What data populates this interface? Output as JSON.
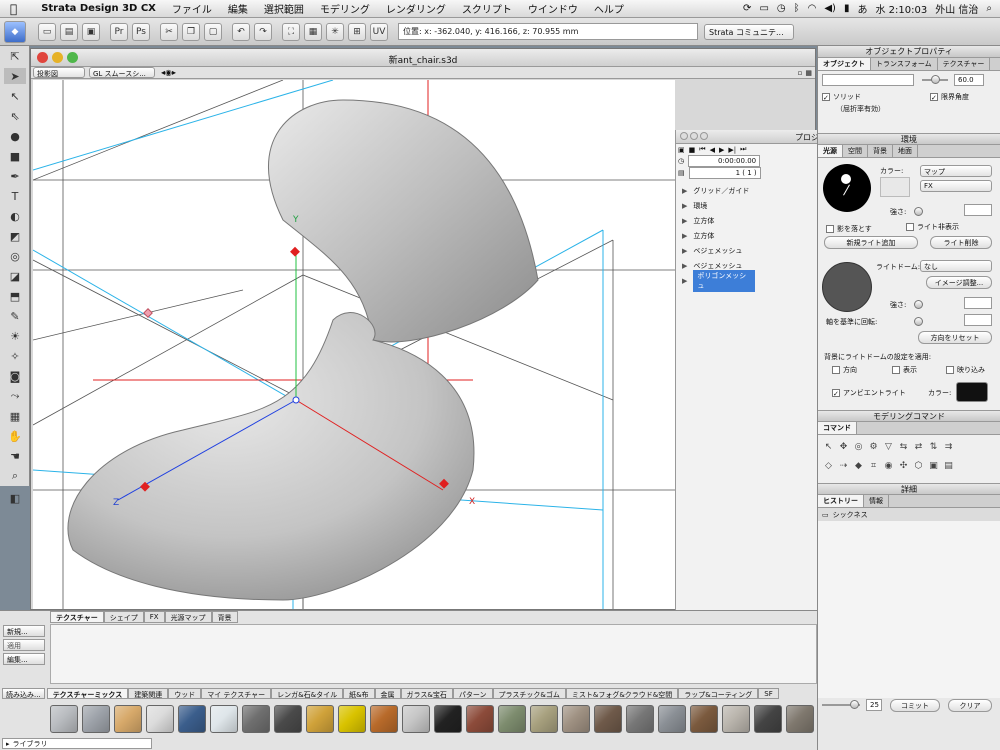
{
  "menubar": {
    "app": "Strata Design 3D CX",
    "items": [
      "ファイル",
      "編集",
      "選択範囲",
      "モデリング",
      "レンダリング",
      "スクリプト",
      "ウインドウ",
      "ヘルプ"
    ],
    "ime": "あ",
    "clock": "水 2:10:03",
    "user": "外山 信治"
  },
  "toolbar": {
    "coords": "位置: x: -362.040, y: 416.166, z: 70.955 mm",
    "community": "Strata コミュニテ..."
  },
  "viewport": {
    "title": "新ant_chair.s3d",
    "projection": "投影図",
    "renderer": "GL スムースシ...",
    "axis_labels": {
      "x": "X",
      "y": "Y",
      "z": "Z"
    }
  },
  "project": {
    "title": "プロジ",
    "time": "0:00:00.00",
    "frame": "1 ( 1 )",
    "items": [
      "グリッド／ガイド",
      "環境",
      "立方体",
      "立方体",
      "ベジェメッシュ",
      "ベジェメッシュ",
      "ポリゴンメッシュ"
    ],
    "selected_index": 6
  },
  "object_props": {
    "title": "オブジェクトプロパティ",
    "tabs": [
      "オブジェクト",
      "トランスフォーム",
      "テクスチャー"
    ],
    "angle_value": "60.0",
    "solid_label": "ソリッド",
    "solid_sub": "（屈折率有効）",
    "limit_angle": "限界角度"
  },
  "environment": {
    "title": "環境",
    "tabs": [
      "光源",
      "空間",
      "背景",
      "地面"
    ],
    "color_label": "カラー:",
    "map_select": "マップ",
    "fx_select": "FX",
    "strength": "強さ:",
    "cast_shadow": "影を落とす",
    "hide_light": "ライト非表示",
    "add_light": "新規ライト追加",
    "delete_light": "ライト削除",
    "light_dome": "ライトドーム:",
    "light_dome_value": "なし",
    "image_adjust": "イメージ調整...",
    "strength2": "強さ:",
    "rotate_axis": "軸を基準に回転:",
    "reset_dir": "方向をリセット",
    "apply_label": "背景にライトドームの設定を適用:",
    "apply_opts": [
      "方向",
      "表示",
      "映り込み"
    ],
    "ambient": "アンビエントライト",
    "ambient_color": "カラー:"
  },
  "modeling": {
    "title": "モデリングコマンド",
    "tab": "コマンド",
    "row1": [
      "↖",
      "✥",
      "◎",
      "⚙",
      "▽",
      "⇆",
      "⇄",
      "⇅",
      "⇉"
    ],
    "row2": [
      "◇",
      "⇢",
      "◆",
      "⌗",
      "◉",
      "✣",
      "⬡",
      "▣",
      "▤"
    ]
  },
  "details": {
    "title": "詳細",
    "tabs": [
      "ヒストリー",
      "情報"
    ],
    "history_item": "シックネス",
    "count": "25",
    "commit": "コミット",
    "clear": "クリア"
  },
  "resources": {
    "side": [
      "新規...",
      "適用",
      "編集..."
    ],
    "load": "読み込み...",
    "tabs": [
      "テクスチャー",
      "シェイプ",
      "FX",
      "光源マップ",
      "背景"
    ],
    "library_tabs": [
      "テクスチャーミックス",
      "建築関連",
      "ウッド",
      "マイ テクスチャー",
      "レンガ&石&タイル",
      "紙&布",
      "金属",
      "ガラス&宝石",
      "パターン",
      "プラスチック&ゴム",
      "ミスト&フォグ&クラウド&空間",
      "ラップ&コーティング",
      "SF"
    ],
    "library": "ライブラリ",
    "swatch_colors": [
      "#b9bcc0",
      "#9ea3aa",
      "#d7a96a",
      "#dcdcdc",
      "#3b5e8c",
      "#dfe6ea",
      "#6f6f6f",
      "#4a4a4a",
      "#d0a23a",
      "#d9c300",
      "#b86a2a",
      "#c6c6c6",
      "#222222",
      "#8c4b3a",
      "#7d8c6e",
      "#a7a07e",
      "#9f9182",
      "#6f5a4a",
      "#777777",
      "#8a8f95",
      "#7b5a3e",
      "#b9b4ac",
      "#444444",
      "#7f786e",
      "#c3b8a7",
      "#2b8f3c",
      "#b13232",
      "#6a30d6"
    ]
  }
}
